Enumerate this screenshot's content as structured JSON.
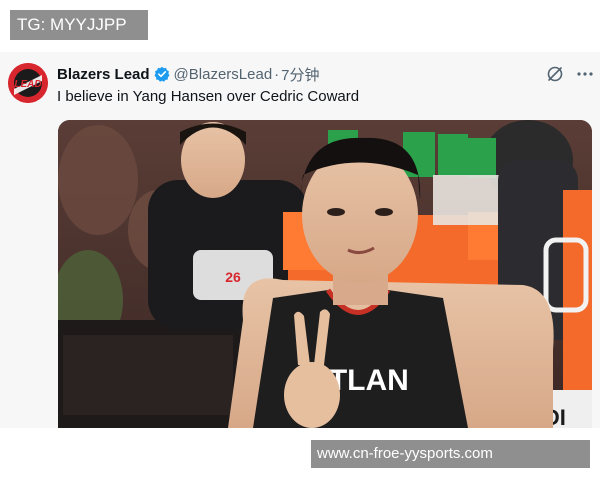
{
  "overlay": {
    "top_tag": "TG: MYYJJPP",
    "bottom_tag": "www.cn-froe-yysports.com"
  },
  "tweet": {
    "display_name": "Blazers Lead",
    "handle": "@BlazersLead",
    "separator": "·",
    "time": "7分钟",
    "text": "I believe in Yang Hansen over Cedric Coward",
    "avatar_text": "LEAD"
  },
  "media": {
    "jersey_text": "RTLAN",
    "corner_text": "ADI"
  },
  "icons": {
    "verified": "verified-badge-icon",
    "grok": "grok-icon",
    "more": "more-icon"
  },
  "colors": {
    "verified": "#1d9bf0",
    "brand_red": "#d8262e",
    "text_primary": "#0f1419",
    "text_secondary": "#536471",
    "overlay_gray": "#8f8f8f"
  }
}
